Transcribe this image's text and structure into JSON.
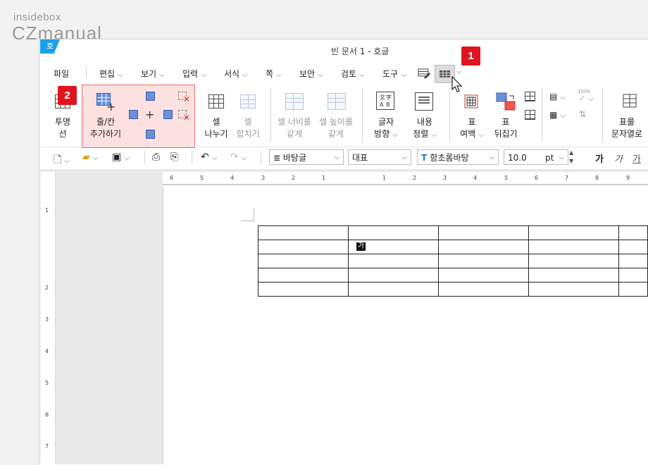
{
  "watermark": {
    "line1": "insidebox",
    "line2": "CZmanual"
  },
  "window": {
    "title": "빈 문서 1 - 호글",
    "app_icon": "호"
  },
  "menu": {
    "file": "파일",
    "items": [
      "편집",
      "보기",
      "입력",
      "서식",
      "쪽",
      "보안",
      "검토",
      "도구"
    ]
  },
  "badges": {
    "one": "1",
    "two": "2"
  },
  "ribbon": {
    "transparent_line": "투명\n선",
    "transparent_1": "투명",
    "transparent_2": "선",
    "add_rowcol_1": "줄/칸",
    "add_rowcol_2": "추가하기",
    "split_1": "셀",
    "split_2": "나누기",
    "merge_1": "셀",
    "merge_2": "합치기",
    "eqwidth_1": "셀 너비를",
    "eqwidth_2": "같게",
    "eqheight_1": "셀 높이를",
    "eqheight_2": "같게",
    "textdir_1": "글자",
    "textdir_2": "방향",
    "align_1": "내용",
    "align_2": "정렬",
    "margin_1": "표",
    "margin_2": "여백",
    "transpose_1": "표",
    "transpose_2": "뒤집기",
    "totext_1": "표를",
    "totext_2": "문자열로",
    "num_label": "1000"
  },
  "toolbar": {
    "style": "바탕글",
    "outline": "대표",
    "font": "함초롬바탕",
    "font_size": "10.0",
    "unit": "pt",
    "bold_glyph": "가",
    "italic_glyph": "가",
    "underline_glyph": "가"
  },
  "ruler": {
    "h_ticks": [
      "6",
      "5",
      "4",
      "3",
      "2",
      "1",
      "1",
      "2",
      "3",
      "4",
      "5",
      "6",
      "7",
      "8",
      "9"
    ],
    "v_ticks": [
      "1",
      "2",
      "3",
      "4",
      "5",
      "6",
      "7"
    ]
  },
  "document": {
    "cursor_char": "가"
  },
  "colors": {
    "badge": "#e0141e",
    "highlight_bg": "#fde1e1",
    "highlight_border": "#e56a6a",
    "app_blue": "#1aa0e8"
  }
}
